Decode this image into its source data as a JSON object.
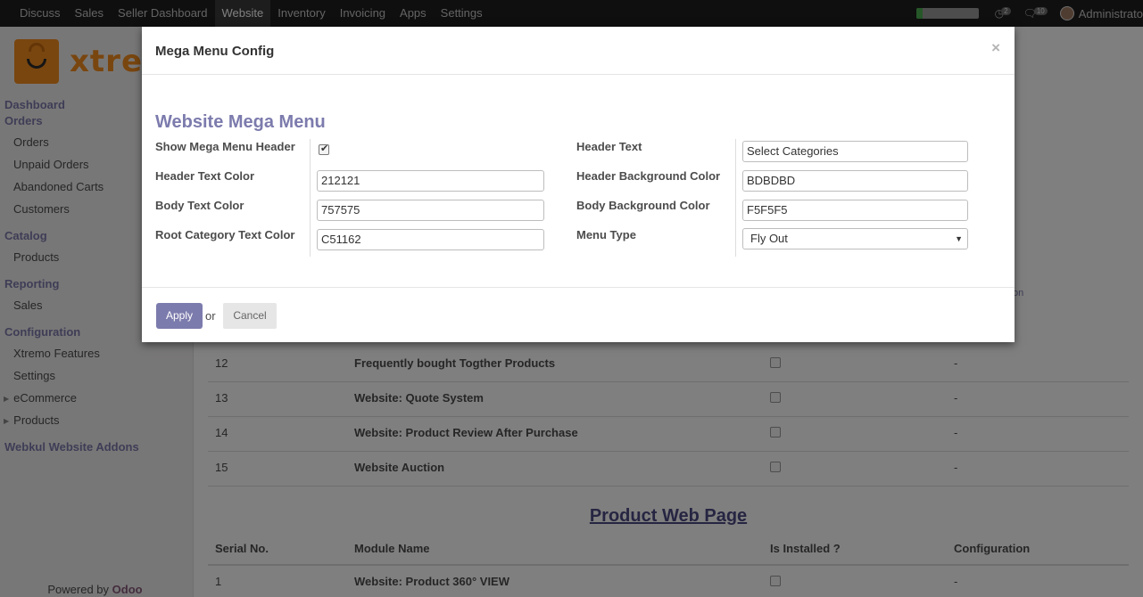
{
  "topbar": {
    "menu": [
      {
        "label": "Discuss",
        "active": false
      },
      {
        "label": "Sales",
        "active": false
      },
      {
        "label": "Seller Dashboard",
        "active": false
      },
      {
        "label": "Website",
        "active": true
      },
      {
        "label": "Inventory",
        "active": false
      },
      {
        "label": "Invoicing",
        "active": false
      },
      {
        "label": "Apps",
        "active": false
      },
      {
        "label": "Settings",
        "active": false
      }
    ],
    "activity_count": "2",
    "messages_count": "10",
    "user_name": "Administrato",
    "progress_level": 0.1
  },
  "sidebar": {
    "logo_text": "xtrem",
    "sections": {
      "dashboard": "Dashboard",
      "orders": "Orders",
      "catalog": "Catalog",
      "reporting": "Reporting",
      "configuration": "Configuration",
      "webkul": "Webkul Website Addons"
    },
    "items": {
      "orders": "Orders",
      "unpaid_orders": "Unpaid Orders",
      "abandoned_carts": "Abandoned Carts",
      "customers": "Customers",
      "products": "Products",
      "sales": "Sales",
      "xtremo_features": "Xtremo Features",
      "settings": "Settings",
      "ecommerce": "eCommerce",
      "products_expand": "Products"
    },
    "powered_by": "Powered by",
    "powered_brand": "Odoo"
  },
  "background_table": {
    "rows": [
      {
        "serial": "12",
        "name": "Frequently bought Togther Products",
        "config": "-"
      },
      {
        "serial": "13",
        "name": "Website: Quote System",
        "config": "-"
      },
      {
        "serial": "14",
        "name": "Website: Product Review After Purchase",
        "config": "-"
      },
      {
        "serial": "15",
        "name": "Website Auction",
        "config": "-"
      }
    ],
    "partial_text": "on"
  },
  "product_section": {
    "heading": "Product Web Page",
    "headers": {
      "serial": "Serial No.",
      "module": "Module Name",
      "installed": "Is Installed ?",
      "config": "Configuration"
    },
    "rows": [
      {
        "serial": "1",
        "name": "Website: Product 360° VIEW",
        "config": "-"
      }
    ]
  },
  "modal": {
    "title": "Mega Menu Config",
    "close": "×",
    "form_title": "Website Mega Menu",
    "fields": {
      "show_header_label": "Show Mega Menu Header",
      "show_header_checked": true,
      "header_text_color_label": "Header Text Color",
      "header_text_color_value": "212121",
      "body_text_color_label": "Body Text Color",
      "body_text_color_value": "757575",
      "root_category_color_label": "Root Category Text Color",
      "root_category_color_value": "C51162",
      "header_text_label": "Header Text",
      "header_text_value": "Select Categories",
      "header_bg_color_label": "Header Background Color",
      "header_bg_color_value": "BDBDBD",
      "body_bg_color_label": "Body Background Color",
      "body_bg_color_value": "F5F5F5",
      "menu_type_label": "Menu Type",
      "menu_type_value": "Fly Out"
    },
    "apply_label": "Apply",
    "or_label": "or",
    "cancel_label": "Cancel"
  },
  "colors": {
    "accent": "#7c7bad",
    "topbar": "#1f1f1f",
    "heading": "#4d4a84",
    "brand": "#875a7b",
    "logo": "#f28d1e"
  }
}
